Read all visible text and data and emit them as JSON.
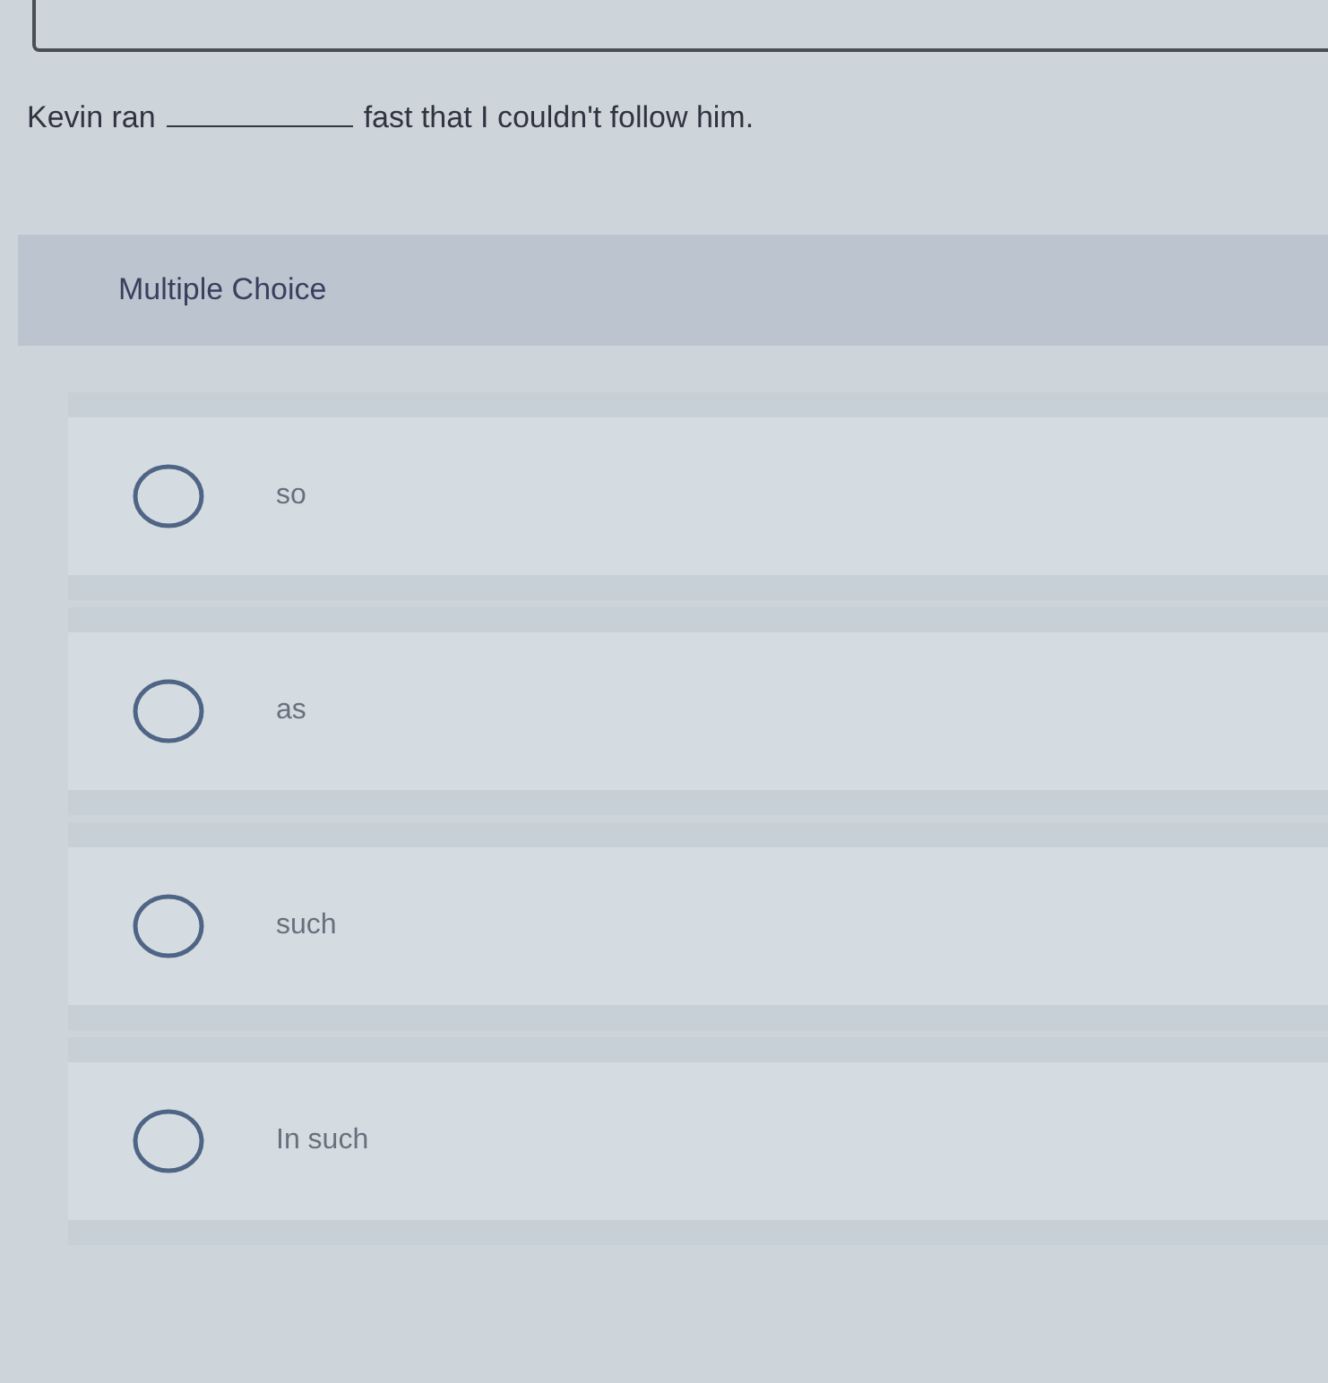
{
  "question": {
    "parts": [
      {
        "kind": "text",
        "text": "Kevin ran"
      },
      {
        "kind": "blank"
      },
      {
        "kind": "text",
        "text": "fast that I couldn't follow him."
      }
    ]
  },
  "section": {
    "title": "Multiple Choice"
  },
  "options": [
    {
      "label": "so",
      "selected": false
    },
    {
      "label": "as",
      "selected": false
    },
    {
      "label": "such",
      "selected": false
    },
    {
      "label": "In such",
      "selected": false
    }
  ]
}
